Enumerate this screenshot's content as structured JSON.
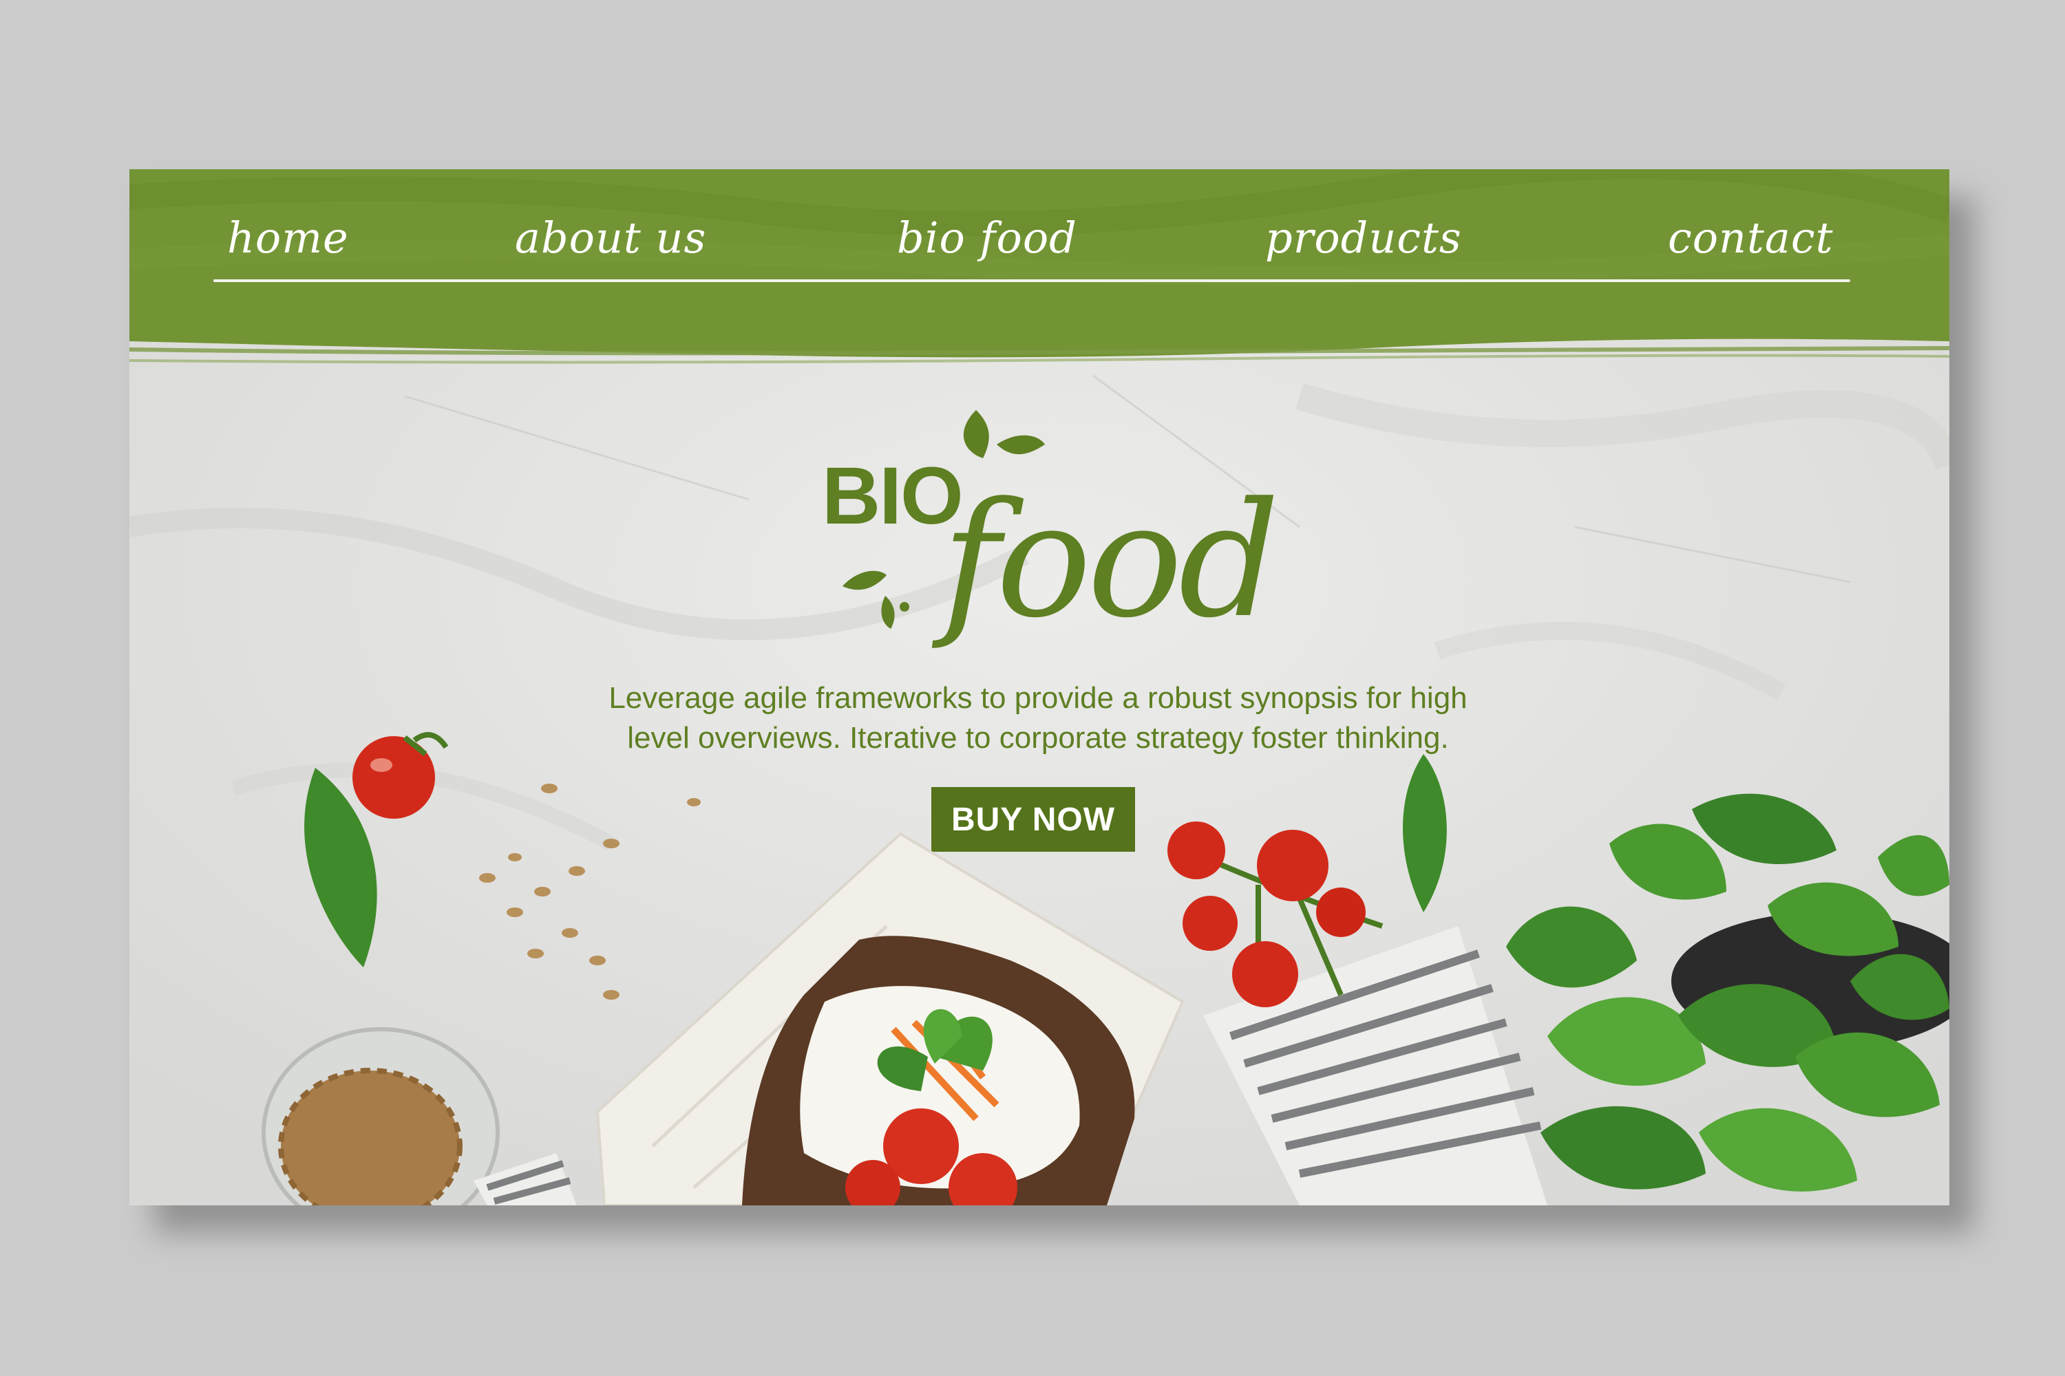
{
  "nav": {
    "items": [
      {
        "label": "home"
      },
      {
        "label": "about us"
      },
      {
        "label": "bio food"
      },
      {
        "label": "products"
      },
      {
        "label": "contact"
      }
    ]
  },
  "hero": {
    "logo_word1": "BIO",
    "logo_word2": "food",
    "tagline_line1": "Leverage agile frameworks to provide a robust synopsis for high",
    "tagline_line2": "level overviews. Iterative to corporate strategy foster thinking.",
    "cta_label": "BUY NOW"
  },
  "colors": {
    "brand_green": "#739434",
    "text_green": "#5e7f22",
    "button_green": "#55731a",
    "page_background": "#cbcbcb"
  }
}
